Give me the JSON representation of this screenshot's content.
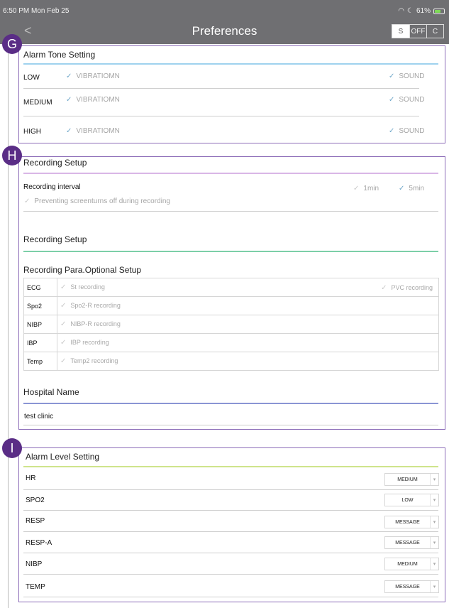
{
  "status_bar": {
    "time": "6:50 PM  Mon Feb 25",
    "battery": "61%"
  },
  "nav": {
    "title": "Preferences",
    "back_glyph": "<",
    "segments": [
      "S",
      "OFF",
      "C"
    ]
  },
  "sections": {
    "g": {
      "badge": "G",
      "title": "Alarm Tone Setting",
      "rows": [
        {
          "label": "LOW",
          "option1": "VIBRATIOMN",
          "option2": "SOUND"
        },
        {
          "label": "MEDIUM",
          "option1": "VIBRATIOMN",
          "option2": "SOUND"
        },
        {
          "label": "HIGH",
          "option1": "VIBRATIOMN",
          "option2": "SOUND"
        }
      ]
    },
    "h": {
      "badge": "H",
      "title": "Recording Setup",
      "interval_label": "Recording interval",
      "interval_opt1": "1min",
      "interval_opt2": "5min",
      "screen_opt": "Preventing screenturns off during recording",
      "subtitle": "Recording Setup",
      "para_title": "Recording Para.Optional Setup",
      "params": [
        {
          "name": "ECG",
          "value": "St recording",
          "extra": "PVC recording"
        },
        {
          "name": "Spo2",
          "value": "Spo2-R recording"
        },
        {
          "name": "NIBP",
          "value": "NIBP-R recording"
        },
        {
          "name": "IBP",
          "value": "IBP recording"
        },
        {
          "name": "Temp",
          "value": "Temp2 recording"
        }
      ],
      "hospital_title": "Hospital Name",
      "hospital_value": "test clinic"
    },
    "i": {
      "badge": "I",
      "title": "Alarm Level Setting",
      "rows": [
        {
          "label": "HR",
          "value": "MEDIUM"
        },
        {
          "label": "SPO2",
          "value": "LOW"
        },
        {
          "label": "RESP",
          "value": "MESSAGE"
        },
        {
          "label": "RESP-A",
          "value": "MESSAGE"
        },
        {
          "label": "NIBP",
          "value": "MEDIUM"
        },
        {
          "label": "TEMP",
          "value": "MESSAGE"
        }
      ]
    }
  },
  "colors": {
    "nav_bg": "#6f6f72",
    "badge": "#5a2d86",
    "box_border": "#8c6cb8",
    "line_blue": "#9fd2ee",
    "line_purple": "#d9b6e6",
    "line_green": "#7ccfa8",
    "line_indigo": "#8a95d4",
    "line_lime": "#cfe48c",
    "check": "#6fa7c9"
  }
}
